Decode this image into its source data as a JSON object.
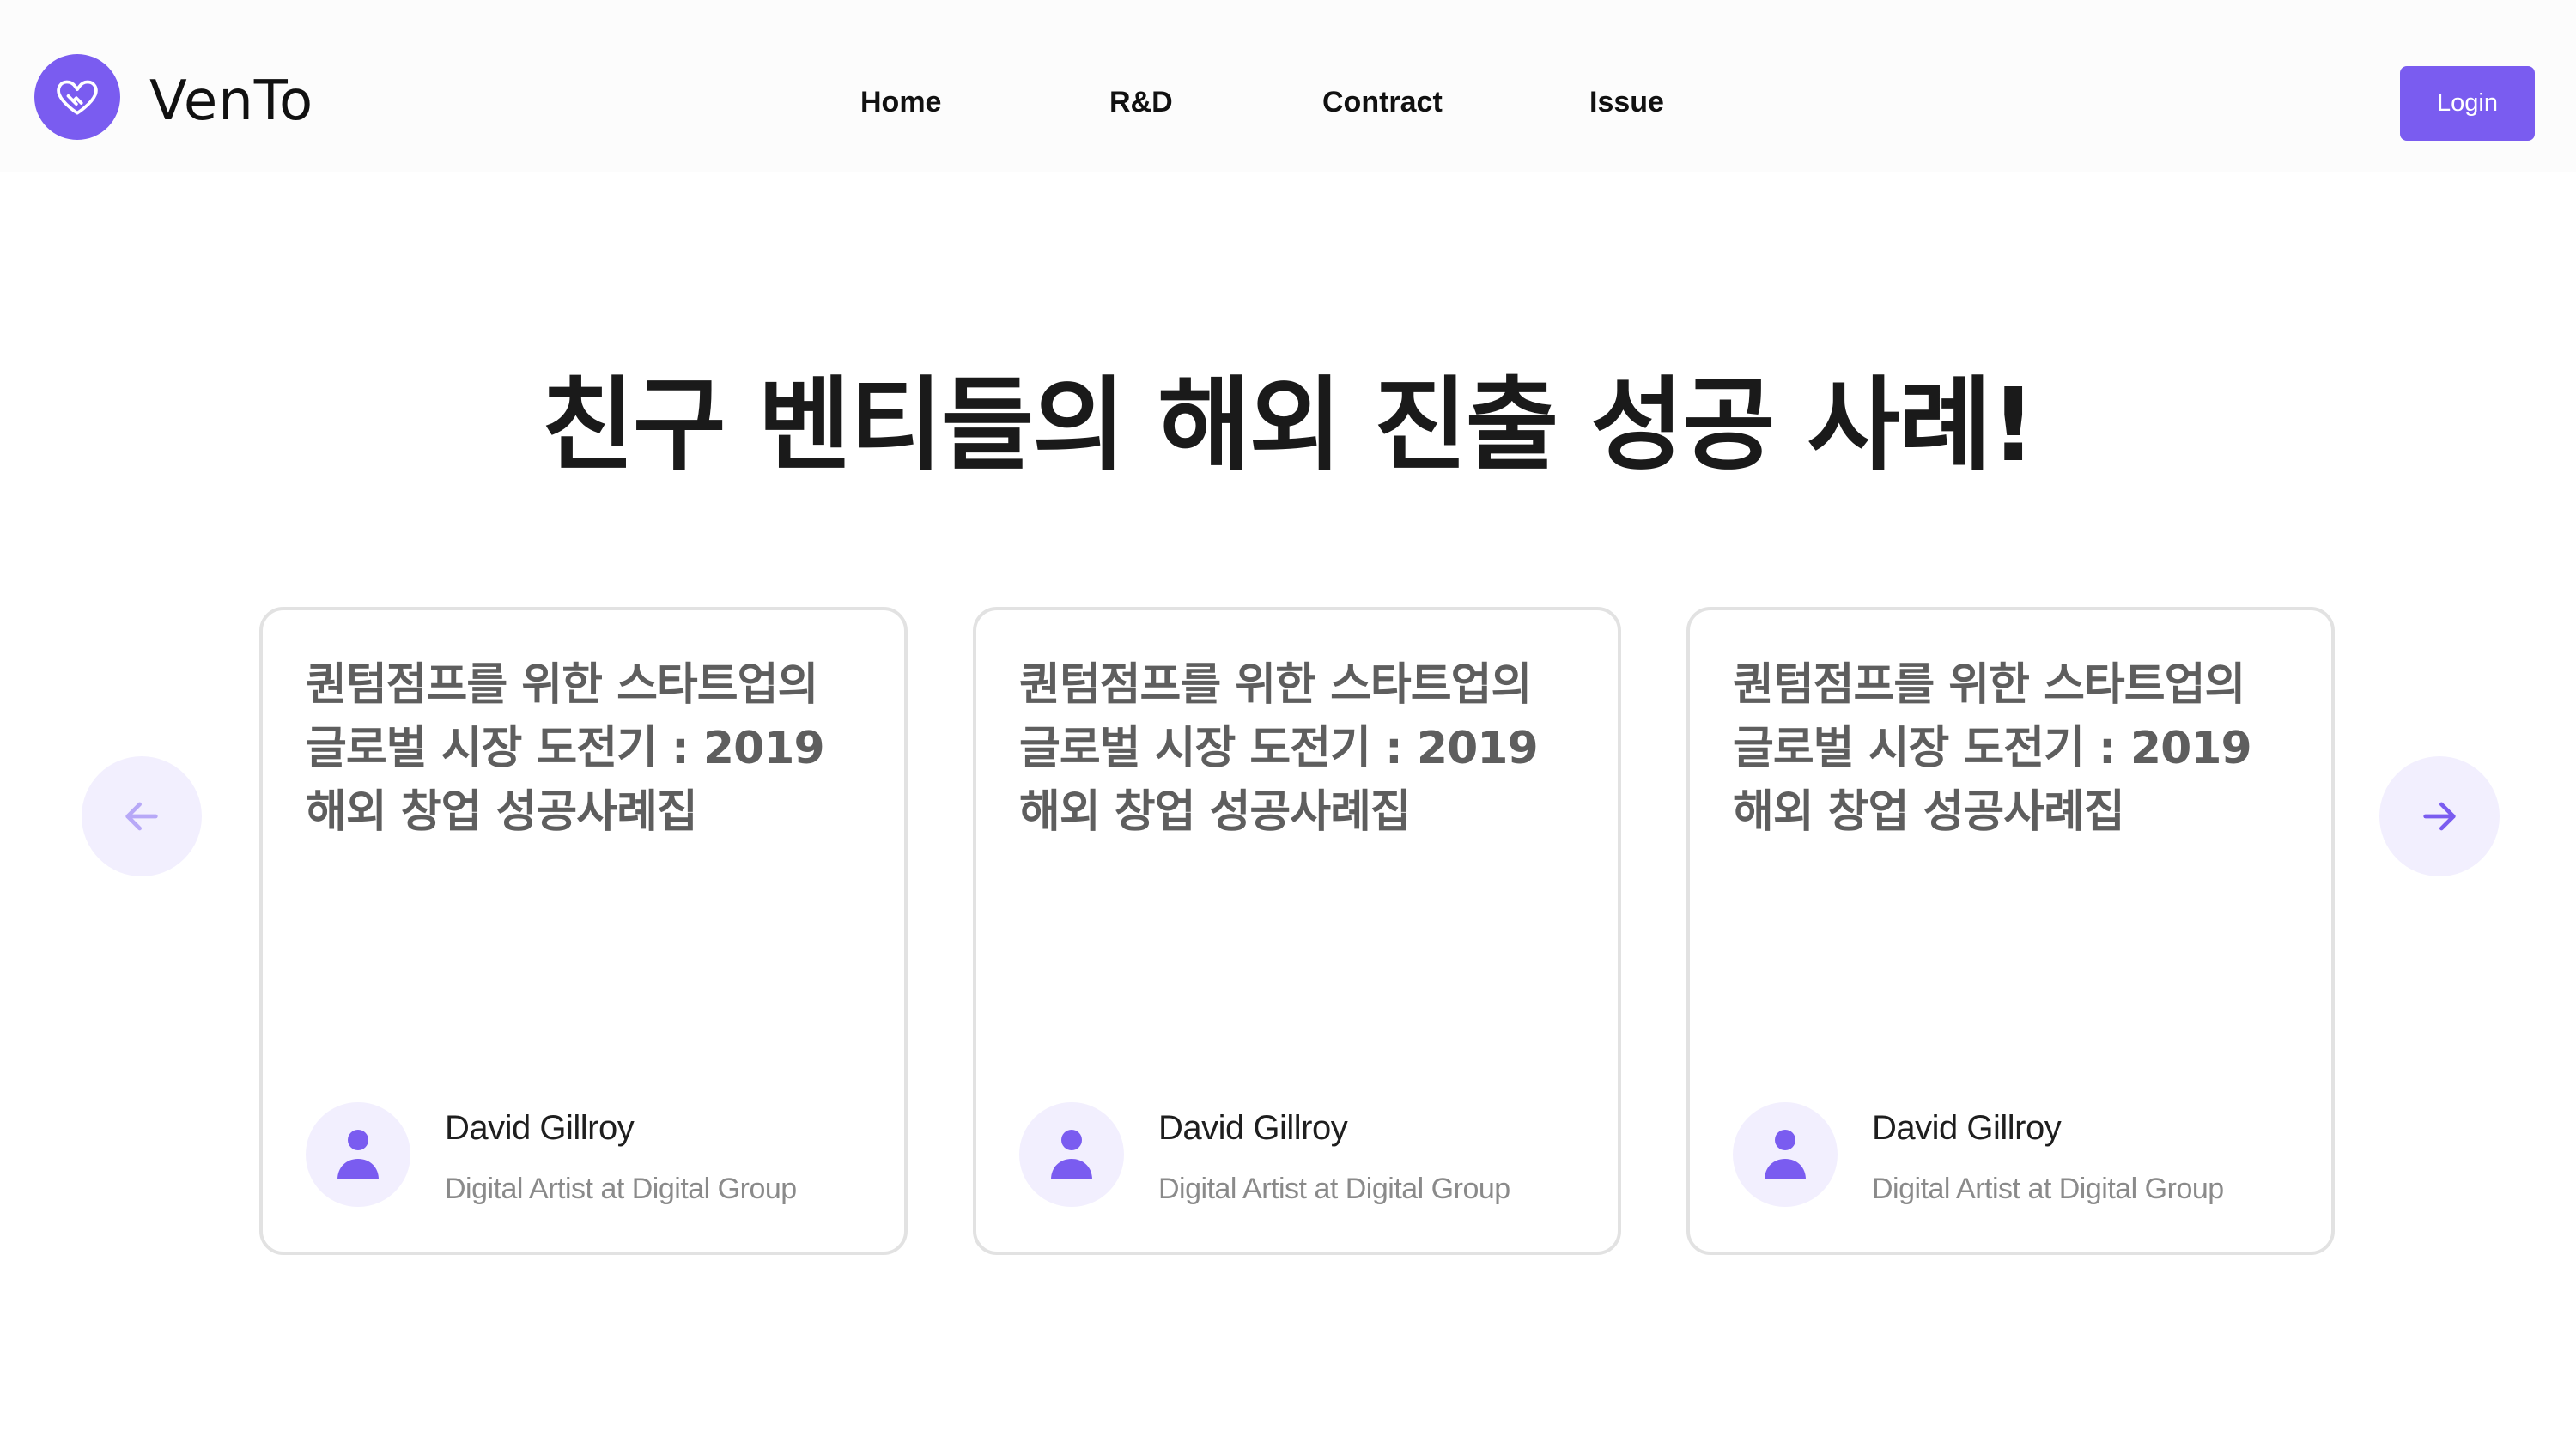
{
  "header": {
    "logo_icon": "heart-handshake-icon",
    "brand": "VenTo",
    "nav": [
      "Home",
      "R&D",
      "Contract",
      "Issue"
    ],
    "login_label": "Login"
  },
  "main": {
    "title": "친구 벤티들의 해외 진출 성공 사례!",
    "prev_icon": "arrow-left-icon",
    "next_icon": "arrow-right-icon",
    "cards": [
      {
        "title": "퀀텀점프를 위한 스타트업의 글로벌 시장 도전기 : 2019 해외 창업 성공사례집",
        "author_icon": "user-icon",
        "author_name": "David Gillroy",
        "author_role": "Digital Artist at Digital Group"
      },
      {
        "title": "퀀텀점프를 위한 스타트업의 글로벌 시장 도전기 : 2019 해외 창업 성공사례집",
        "author_icon": "user-icon",
        "author_name": "David Gillroy",
        "author_role": "Digital Artist at Digital Group"
      },
      {
        "title": "퀀텀점프를 위한 스타트업의 글로벌 시장 도전기 : 2019 해외 창업 성공사례집",
        "author_icon": "user-icon",
        "author_name": "David Gillroy",
        "author_role": "Digital Artist at Digital Group"
      }
    ]
  },
  "colors": {
    "accent": "#7a5cf0",
    "accent_light": "#f2effe",
    "card_border": "#e2e2e2"
  }
}
